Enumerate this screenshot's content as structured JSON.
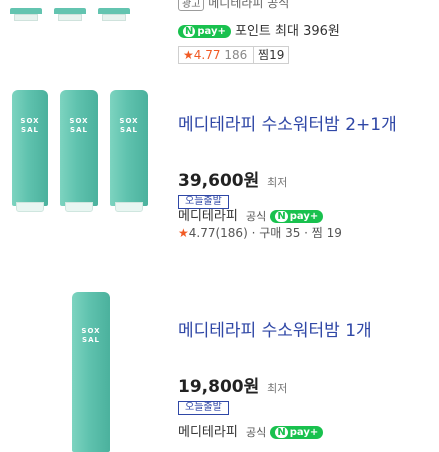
{
  "top_product": {
    "ad_prefix": "광고",
    "store": "메디테라피 공식",
    "npay_label": "pay+",
    "point_text": "포인트 최대 396원",
    "rating": "★4.77",
    "review_count": "186",
    "zzim": "찜19"
  },
  "products": [
    {
      "title": "메디테라피 수소워터밤 2+1개",
      "price": "39,600원",
      "compare_label": "최저",
      "badge": "오늘출발",
      "seller": "메디테라피",
      "seller_tag": "공식",
      "npay_label": "pay+",
      "meta": "4.77(186) · 구매 35 · 찜 19",
      "tube_label": "SOX\nSAL"
    },
    {
      "title": "메디테라피 수소워터밤 1개",
      "price": "19,800원",
      "compare_label": "최저",
      "badge": "오늘출발",
      "seller": "메디테라피",
      "seller_tag": "공식",
      "npay_label": "pay+",
      "tube_label": "SOX\nSAL"
    }
  ],
  "colors": {
    "title_blue": "#2f47a6",
    "npay_green": "#19c14e",
    "tube_mint": "#5fc2ae",
    "star_orange": "#f15a24"
  }
}
